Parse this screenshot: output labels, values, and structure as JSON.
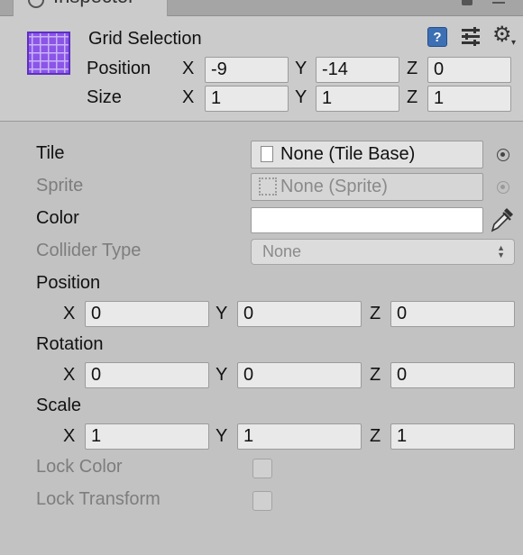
{
  "tab": {
    "title": "Inspector"
  },
  "header": {
    "object_title": "Grid Selection",
    "position_label": "Position",
    "size_label": "Size",
    "axes": [
      "X",
      "Y",
      "Z"
    ],
    "position": {
      "x": "-9",
      "y": "-14",
      "z": "0"
    },
    "size": {
      "x": "1",
      "y": "1",
      "z": "1"
    },
    "help_glyph": "?"
  },
  "tile": {
    "label": "Tile",
    "value": "None (Tile Base)"
  },
  "sprite": {
    "label": "Sprite",
    "value": "None (Sprite)"
  },
  "color": {
    "label": "Color",
    "value": "#ffffff"
  },
  "collider_type": {
    "label": "Collider Type",
    "value": "None"
  },
  "transform": {
    "axes": [
      "X",
      "Y",
      "Z"
    ],
    "position": {
      "label": "Position",
      "x": "0",
      "y": "0",
      "z": "0"
    },
    "rotation": {
      "label": "Rotation",
      "x": "0",
      "y": "0",
      "z": "0"
    },
    "scale": {
      "label": "Scale",
      "x": "1",
      "y": "1",
      "z": "1"
    }
  },
  "lock_color": {
    "label": "Lock Color",
    "checked": false
  },
  "lock_transform": {
    "label": "Lock Transform",
    "checked": false
  },
  "icons": [
    "grid-icon",
    "help-icon",
    "preset-icon",
    "gear-icon",
    "lock-icon",
    "menu-icon",
    "document-icon",
    "sprite-icon",
    "object-picker-icon",
    "eyedropper-icon",
    "dropdown-arrows-icon"
  ]
}
